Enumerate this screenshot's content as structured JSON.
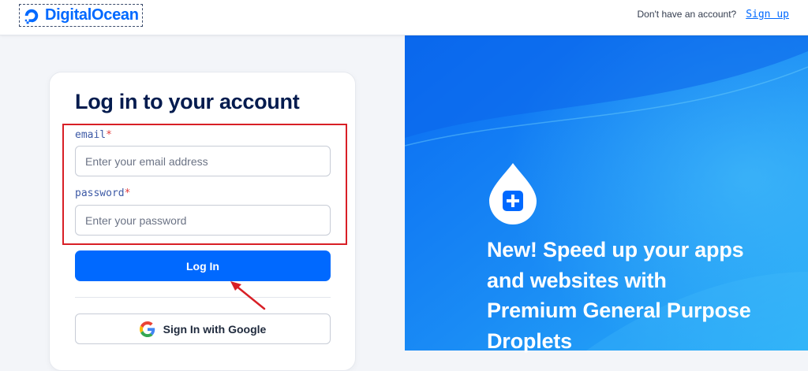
{
  "header": {
    "logo_text": "DigitalOcean",
    "no_account_text": "Don't have an account?",
    "signup_label": "Sign up"
  },
  "login": {
    "title": "Log in to your account",
    "email_label": "email",
    "password_label": "password",
    "required_mark": "*",
    "email_placeholder": "Enter your email address",
    "password_placeholder": "Enter your password",
    "login_button": "Log In",
    "google_button": "Sign In with Google"
  },
  "promo": {
    "text": "New! Speed up your apps and websites with Premium General Purpose Droplets"
  },
  "icons": {
    "logo": "digitalocean-logo-icon",
    "google": "google-icon",
    "droplet": "droplet-plus-icon",
    "annotation": "red-arrow-icon"
  },
  "colors": {
    "brand_blue": "#0069ff",
    "title_navy": "#031b4e",
    "annotation_red": "#d81f26",
    "promo_bg": "#0f7df5"
  }
}
